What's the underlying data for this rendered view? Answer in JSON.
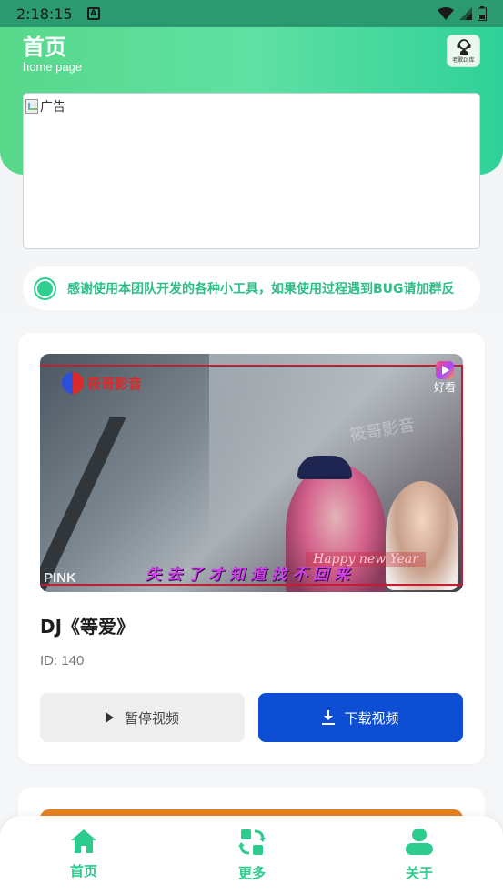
{
  "status_bar": {
    "time": "2:18:15",
    "badge": "A"
  },
  "header": {
    "title": "首页",
    "subtitle": "home page",
    "logo_label": "老歌DJ库"
  },
  "ad": {
    "alt_text": "广告"
  },
  "notice": {
    "text": "感谢使用本团队开发的各种小工具，如果使用过程遇到BUG请加群反"
  },
  "video": {
    "title": "DJ《等爱》",
    "id_text": "ID: 140",
    "thumb_logo": "筱哥影音",
    "thumb_watermark": "筱哥影音",
    "thumb_app_label": "好看",
    "thumb_pink": "PINK",
    "thumb_lyrics": "失去了才知道找不回来",
    "thumb_happy": "Happy new Year",
    "pause_label": "暂停视频",
    "download_label": "下载视频"
  },
  "tabs": [
    {
      "label": "首页",
      "icon": "home-icon"
    },
    {
      "label": "更多",
      "icon": "refresh-icon"
    },
    {
      "label": "关于",
      "icon": "user-icon"
    }
  ],
  "colors": {
    "accent": "#2ecb8e",
    "download_button": "#0d4ed4",
    "header_gradient_start": "#58d88a",
    "header_gradient_end": "#2fd19a"
  }
}
